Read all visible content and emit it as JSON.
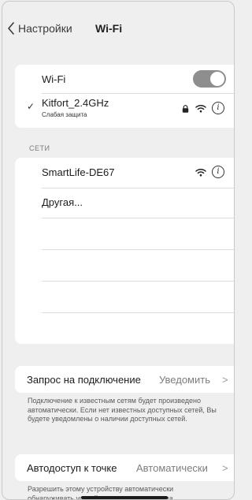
{
  "nav": {
    "back_label": "Настройки",
    "title": "Wi-Fi"
  },
  "wifi_group": {
    "toggle_label": "Wi-Fi",
    "toggle_on": true,
    "connected_name": "Kitfort_2.4GHz",
    "connected_subtitle": "Слабая защита"
  },
  "networks": {
    "header": "СЕТИ",
    "items": [
      "SmartLife-DE67"
    ],
    "other_label": "Другая..."
  },
  "ask_join": {
    "label": "Запрос на подключение",
    "value": "Уведомить",
    "description": "Подключение к известным сетям будет произведено автоматически. Если нет известных доступных сетей, Вы будете уведомлены о наличии доступных сетей."
  },
  "auto_hotspot": {
    "label": "Автодоступ к точке",
    "value": "Автоматически",
    "description": "Разрешить этому устройству автоматически обнаруживать устройства в режиме модема"
  },
  "colors": {
    "toggle": "#8e8e8e",
    "background": "#efefef",
    "cell": "#ffffff"
  },
  "icons": [
    "chevron-left-icon",
    "checkmark-icon",
    "lock-icon",
    "wifi-icon",
    "info-icon",
    "chevron-right-icon"
  ]
}
